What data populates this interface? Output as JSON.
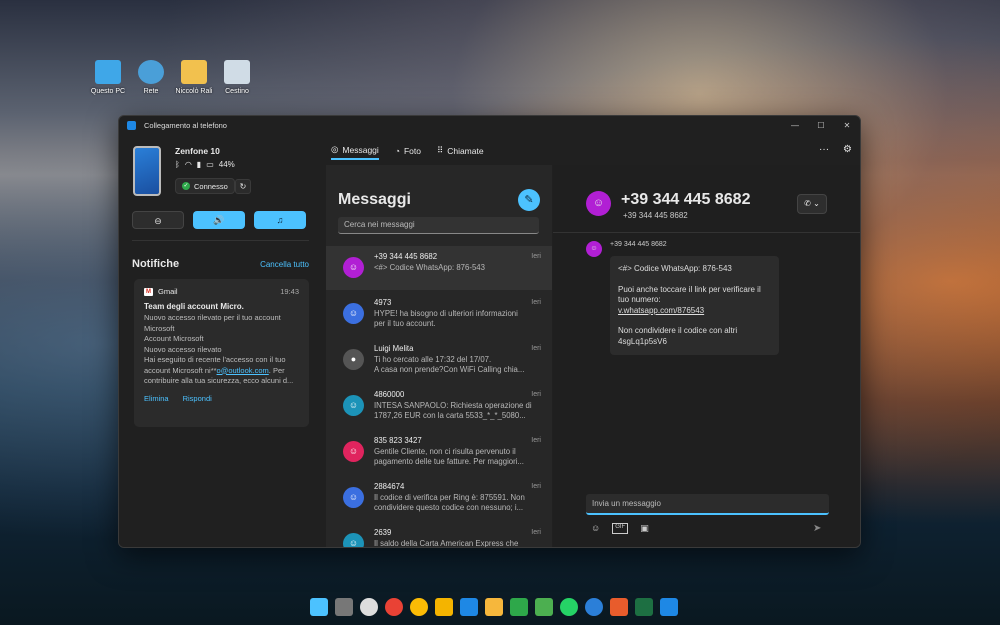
{
  "desktop": {
    "icons": [
      {
        "label": "Questo PC",
        "color": "#3fa7e8"
      },
      {
        "label": "Rete",
        "color": "#4a9fd8"
      },
      {
        "label": "Niccolò Rali",
        "color": "#f2c14e"
      },
      {
        "label": "Cestino",
        "color": "#d0dce6"
      }
    ]
  },
  "window": {
    "title": "Collegamento al telefono",
    "controls": [
      "—",
      "☐",
      "✕"
    ]
  },
  "device": {
    "name": "Zenfone 10",
    "battery": "44%",
    "status": "Connesso",
    "action_icons": [
      "⊖",
      "🔊",
      "♫"
    ]
  },
  "notifications": {
    "title": "Notifiche",
    "clear_label": "Cancella tutto",
    "items": [
      {
        "app": "Gmail",
        "time": "19:43",
        "subject": "Team degli account Micro.",
        "body_1": "Nuovo accesso rilevato per il tuo account Microsoft",
        "body_2": "Account Microsoft",
        "body_3": "Nuovo accesso rilevato",
        "body_4": "Hai eseguito di recente l'accesso con il tuo account Microsoft ni**",
        "body_link": "o@outlook.com",
        "body_5": ". Per contribuire alla tua sicurezza, ecco alcuni d...",
        "action_1": "Elimina",
        "action_2": "Rispondi"
      }
    ]
  },
  "tabs": [
    {
      "label": "Messaggi",
      "icon": "◎",
      "active": true
    },
    {
      "label": "Foto",
      "icon": "◔",
      "active": false
    },
    {
      "label": "Chiamate",
      "icon": "⠿",
      "active": false
    }
  ],
  "top_right": {
    "more": "···",
    "settings": "⚙"
  },
  "messages": {
    "title": "Messaggi",
    "search_placeholder": "Cerca nei messaggi",
    "conversations": [
      {
        "name": "+39 344 445 8682",
        "preview_1": "<#> Codice WhatsApp: 876-543",
        "preview_2": "",
        "day": "Ieri",
        "color": "#b11fd4"
      },
      {
        "name": "4973",
        "preview_1": "HYPE! ha bisogno di ulteriori informazioni",
        "preview_2": "per il tuo account.",
        "day": "Ieri",
        "color": "#3b6fe0"
      },
      {
        "name": "Luigi Melita",
        "preview_1": "Ti ho cercato alle 17:32 del 17/07.",
        "preview_2": "A casa non prende?Con WiFi Calling chia...",
        "day": "Ieri",
        "color": "#555555"
      },
      {
        "name": "4860000",
        "preview_1": "INTESA SANPAOLO: Richiesta operazione di",
        "preview_2": "1787,26 EUR con la carta 5533_*_*_5080...",
        "day": "Ieri",
        "color": "#1c93b8"
      },
      {
        "name": "835 823 3427",
        "preview_1": "Gentile Cliente, non ci risulta pervenuto il",
        "preview_2": "pagamento delle tue fatture. Per maggiori...",
        "day": "Ieri",
        "color": "#e0245e"
      },
      {
        "name": "2884674",
        "preview_1": "Il codice di verifica per Ring è: 875591. Non",
        "preview_2": "condividere questo codice con nessuno; i...",
        "day": "Ieri",
        "color": "#3b6fe0"
      },
      {
        "name": "2639",
        "preview_1": "Il saldo della Carta American Express che",
        "preview_2": "",
        "day": "Ieri",
        "color": "#1c93b8"
      }
    ]
  },
  "conversation": {
    "name": "+39 344 445 8682",
    "subtitle": "+39 344 445 8682",
    "sender": "+39 344 445 8682",
    "call_label": "✆ ⌄",
    "message_1": "<#> Codice WhatsApp: 876-543",
    "message_2": "Puoi anche toccare il link per verificare il tuo numero:",
    "message_link": "v.whatsapp.com/876543",
    "message_3": "Non condividere il codice con altri",
    "message_4": "4sgLq1p5sV6",
    "input_placeholder": "Invia un messaggio",
    "tool_icons": [
      "☺",
      "GIF",
      "▣"
    ],
    "send_icon": "➤"
  },
  "taskbar": {
    "icons": [
      "#4cc2ff",
      "#777777",
      "#dddddd",
      "#e94235",
      "#fbbc05",
      "#f4b400",
      "#1e88e5",
      "#f6b73c",
      "#2ea84a",
      "#4caf50",
      "#25d366",
      "#2b7fd8",
      "#e85c2c",
      "#1d6f42",
      "#1e88e5"
    ]
  }
}
